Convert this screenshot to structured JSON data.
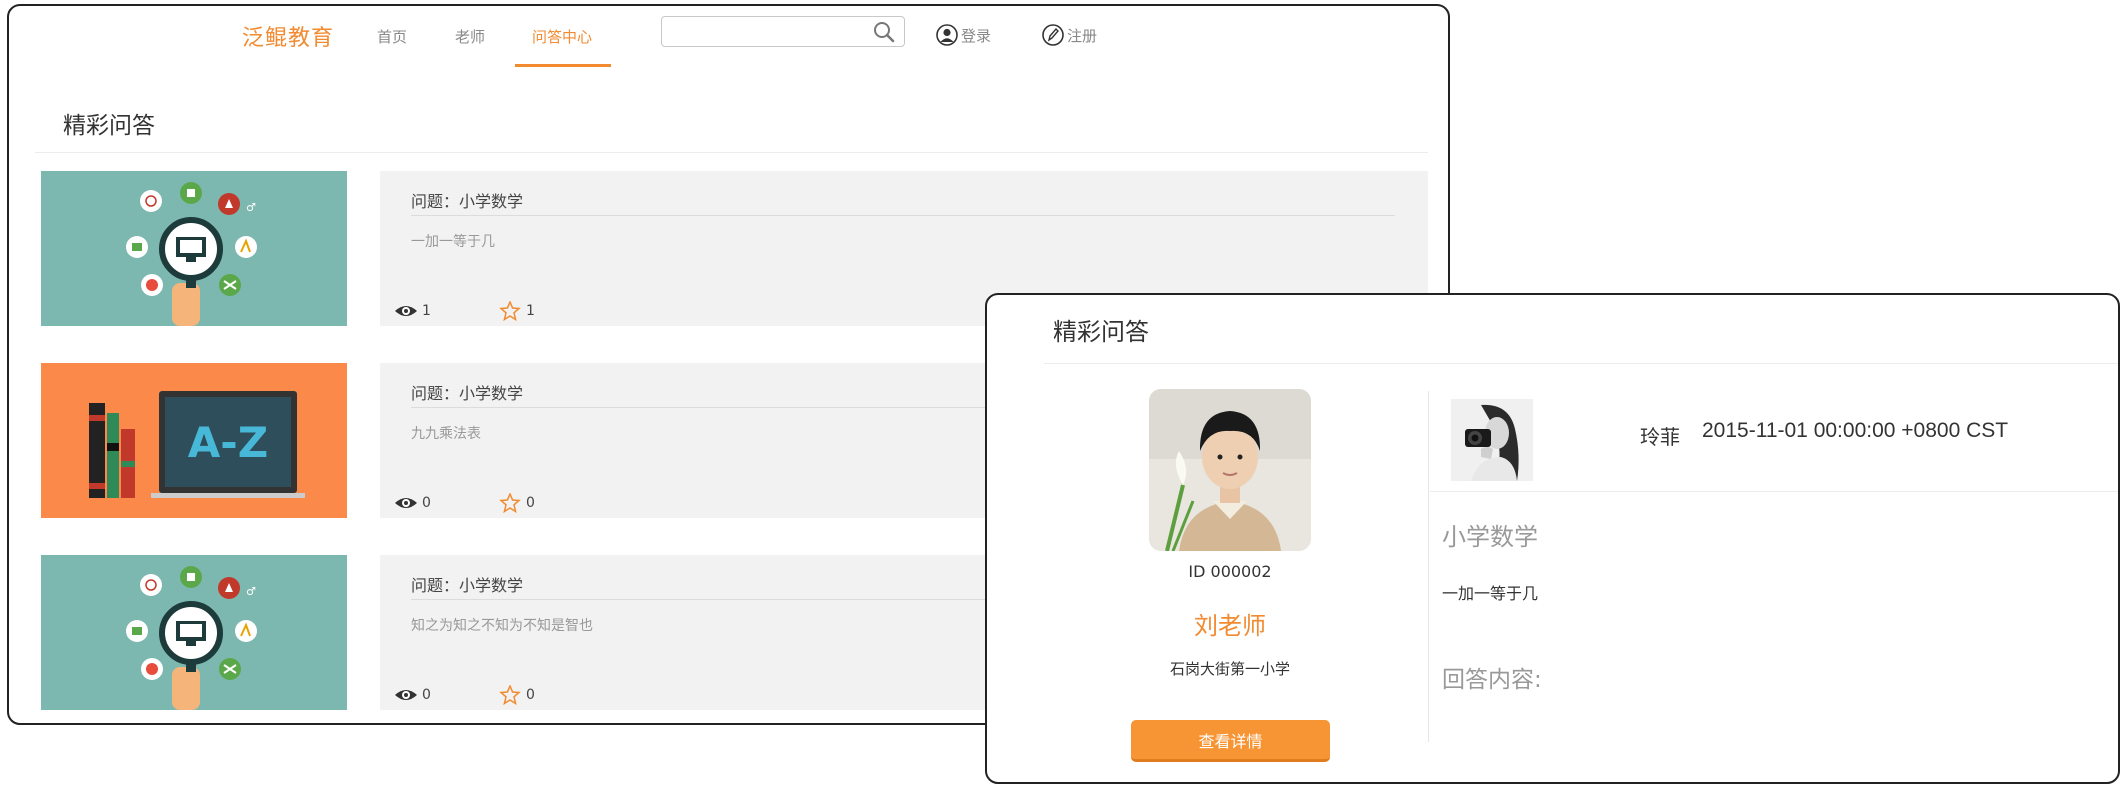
{
  "nav": {
    "brand": "泛鲲教育",
    "links": [
      {
        "label": "首页"
      },
      {
        "label": "老师"
      },
      {
        "label": "问答中心"
      }
    ],
    "search": {
      "placeholder": ""
    },
    "login": "登录",
    "register": "注册"
  },
  "list": {
    "title": "精彩问答",
    "items": [
      {
        "question": "问题：小学数学",
        "description": "一加一等于几",
        "views": "1",
        "stars": "1"
      },
      {
        "question": "问题：小学数学",
        "description": "九九乘法表",
        "views": "0",
        "stars": "0"
      },
      {
        "question": "问题：小学数学",
        "description": "知之为知之不知为不知是智也",
        "views": "0",
        "stars": "0"
      }
    ],
    "thumb_text": "A-Z"
  },
  "detail": {
    "title": "精彩问答",
    "teacher": {
      "id": "ID 000002",
      "name": "刘老师",
      "school": "石岗大街第一小学",
      "button": "查看详情"
    },
    "asker": {
      "name": "玲菲",
      "date": "2015-11-01 00:00:00 +0800 CST"
    },
    "subject": "小学数学",
    "question": "一加一等于几",
    "answer_label": "回答内容:"
  },
  "colors": {
    "accent": "#f28a30",
    "teal_thumb": "#7db8b0",
    "orange_thumb": "#fb8a4a"
  }
}
